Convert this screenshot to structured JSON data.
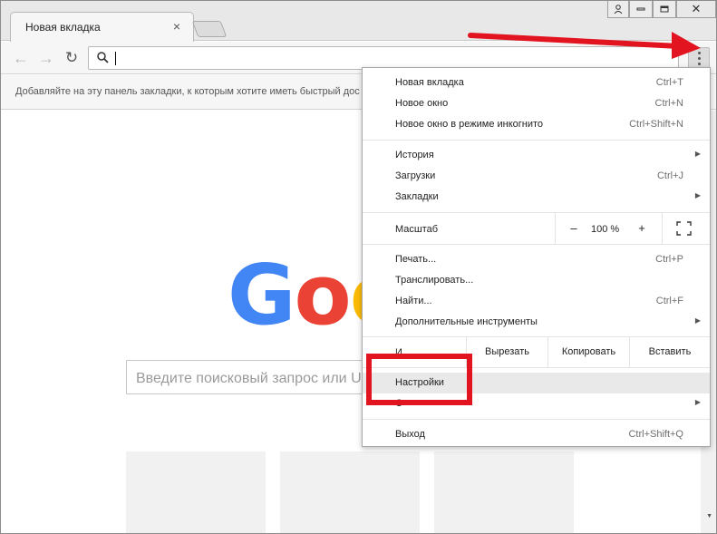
{
  "tab": {
    "title": "Новая вкладка",
    "close": "×"
  },
  "window": {
    "user_icon": "user-icon",
    "minimize": "▭",
    "restore": "▢",
    "close": "✕"
  },
  "toolbar": {
    "back": "←",
    "forward": "→",
    "reload": "↻",
    "omnibox_value": ""
  },
  "bookmarks": {
    "hint": "Добавляйте на эту панель закладки, к которым хотите иметь быстрый дос"
  },
  "google": {
    "letters": [
      "G",
      "o",
      "o"
    ]
  },
  "search": {
    "placeholder": "Введите поисковый запрос или U"
  },
  "menu": {
    "items": [
      {
        "label": "Новая вкладка",
        "shortcut": "Ctrl+T"
      },
      {
        "label": "Новое окно",
        "shortcut": "Ctrl+N"
      },
      {
        "label": "Новое окно в режиме инкогнито",
        "shortcut": "Ctrl+Shift+N"
      },
      {
        "label": "История",
        "shortcut": "",
        "submenu": true
      },
      {
        "label": "Загрузки",
        "shortcut": "Ctrl+J"
      },
      {
        "label": "Закладки",
        "shortcut": "",
        "submenu": true
      },
      {
        "label": "Печать...",
        "shortcut": "Ctrl+P"
      },
      {
        "label": "Транслировать...",
        "shortcut": ""
      },
      {
        "label": "Найти...",
        "shortcut": "Ctrl+F"
      },
      {
        "label": "Дополнительные инструменты",
        "shortcut": "",
        "submenu": true
      },
      {
        "label": "Настройки",
        "shortcut": ""
      },
      {
        "label": "С",
        "shortcut": "",
        "submenu": true
      },
      {
        "label": "Выход",
        "shortcut": "Ctrl+Shift+Q"
      }
    ],
    "zoom": {
      "label": "Масштаб",
      "minus": "–",
      "value": "100 %",
      "plus": "+"
    },
    "edit": {
      "label": "И",
      "cut": "Вырезать",
      "copy": "Копировать",
      "paste": "Вставить"
    },
    "submenu_arrow": "▶"
  },
  "colors": {
    "annotation_red": "#e2141f",
    "google_blue": "#4285f4",
    "google_red": "#ea4335",
    "google_yellow": "#fbbc05"
  }
}
